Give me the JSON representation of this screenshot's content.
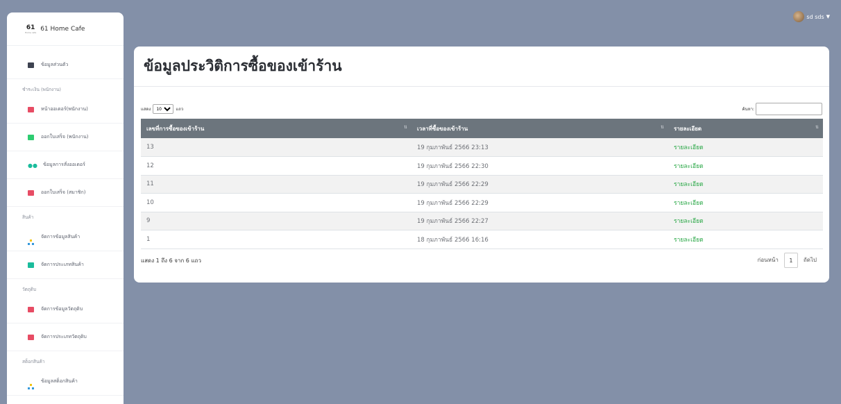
{
  "brand": {
    "logo_number": "61",
    "logo_sub": "Home cafe",
    "name": "61 Home Cafe"
  },
  "user": {
    "name": "sd sds"
  },
  "sidebar": {
    "profile": "ข้อมูลส่วนตัว",
    "sections": [
      {
        "heading": "ชำระเงิน (พนักงาน)",
        "items": [
          "หน้าออเดอร์(พนักงาน)",
          "ออกใบเสร็จ (พนักงาน)",
          "ข้อมูลการสั่งออเดอร์",
          "ออกใบเสร็จ (สมาชิก)"
        ]
      },
      {
        "heading": "สินค้า",
        "items": [
          "จัดการข้อมูลสินค้า",
          "จัดการประเภทสินค้า"
        ]
      },
      {
        "heading": "วัตถุดิบ",
        "items": [
          "จัดการข้อมูลวัตถุดิบ",
          "จัดการประเภทวัตถุดิบ"
        ]
      },
      {
        "heading": "สต็อกสินค้า",
        "items": [
          "ข้อมูลสต็อกสินค้า"
        ]
      }
    ]
  },
  "page": {
    "title": "ข้อมูลประวิติการซื้อของเข้าร้าน"
  },
  "table_controls": {
    "show_prefix": "แสดง",
    "page_length": "10",
    "show_suffix": "แถว",
    "search_label": "ค้นหา:"
  },
  "table": {
    "headers": [
      "เลขที่การซื้อของเข้าร้าน",
      "เวลาที่ซื้อของเข้าร้าน",
      "รายละเอียด"
    ],
    "rows": [
      {
        "id": "13",
        "time": "19 กุมภาพันธ์ 2566 23:13",
        "detail": "รายละเอียด"
      },
      {
        "id": "12",
        "time": "19 กุมภาพันธ์ 2566 22:30",
        "detail": "รายละเอียด"
      },
      {
        "id": "11",
        "time": "19 กุมภาพันธ์ 2566 22:29",
        "detail": "รายละเอียด"
      },
      {
        "id": "10",
        "time": "19 กุมภาพันธ์ 2566 22:29",
        "detail": "รายละเอียด"
      },
      {
        "id": "9",
        "time": "19 กุมภาพันธ์ 2566 22:27",
        "detail": "รายละเอียด"
      },
      {
        "id": "1",
        "time": "18 กุมภาพันธ์ 2566 16:16",
        "detail": "รายละเอียด"
      }
    ]
  },
  "footer": {
    "info": "แสดง 1 ถึง 6 จาก 6 แถว",
    "prev": "ก่อนหน้า",
    "page": "1",
    "next": "ถัดไป"
  }
}
